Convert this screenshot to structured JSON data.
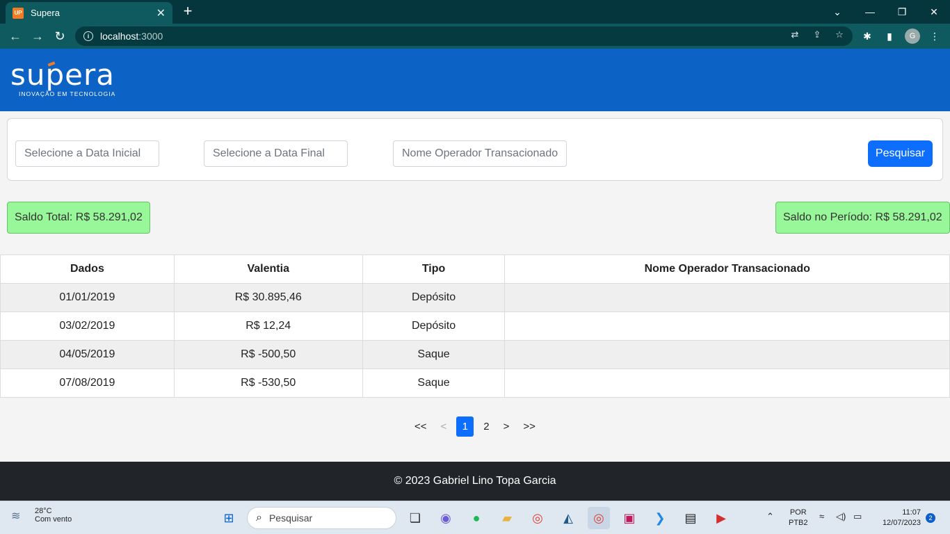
{
  "browser": {
    "tab_title": "Supera",
    "favicon_text": "UP",
    "url_host": "localhost",
    "url_port": ":3000"
  },
  "header": {
    "brand": "supera",
    "tagline": "INOVAÇÃO EM TECNOLOGIA"
  },
  "filters": {
    "start_date_placeholder": "Selecione a Data Inicial",
    "end_date_placeholder": "Selecione a Data Final",
    "operator_placeholder": "Nome Operador Transacionado",
    "search_label": "Pesquisar"
  },
  "balances": {
    "total": "Saldo Total: R$ 58.291,02",
    "period": "Saldo no Período: R$ 58.291,02"
  },
  "table": {
    "headers": [
      "Dados",
      "Valentia",
      "Tipo",
      "Nome Operador Transacionado"
    ],
    "rows": [
      [
        "01/01/2019",
        "R$ 30.895,46",
        "Depósito",
        ""
      ],
      [
        "03/02/2019",
        "R$ 12,24",
        "Depósito",
        ""
      ],
      [
        "04/05/2019",
        "R$ -500,50",
        "Saque",
        ""
      ],
      [
        "07/08/2019",
        "R$ -530,50",
        "Saque",
        ""
      ]
    ]
  },
  "pagination": {
    "first": "<<",
    "prev": "<",
    "pages": [
      "1",
      "2"
    ],
    "current": "1",
    "next": ">",
    "last": ">>"
  },
  "footer": {
    "text": "© 2023 Gabriel Lino Topa Garcia"
  },
  "taskbar": {
    "temperature": "28°C",
    "weather": "Com vento",
    "search_placeholder": "Pesquisar",
    "lang_top": "POR",
    "lang_bottom": "PTB2",
    "time": "11:07",
    "date": "12/07/2023",
    "notifications": "2"
  },
  "colors": {
    "header_blue": "#0c63c5",
    "primary_button": "#0d6efd",
    "balance_green": "#98f798",
    "footer_dark": "#212529",
    "brand_orange": "#f47b20"
  }
}
